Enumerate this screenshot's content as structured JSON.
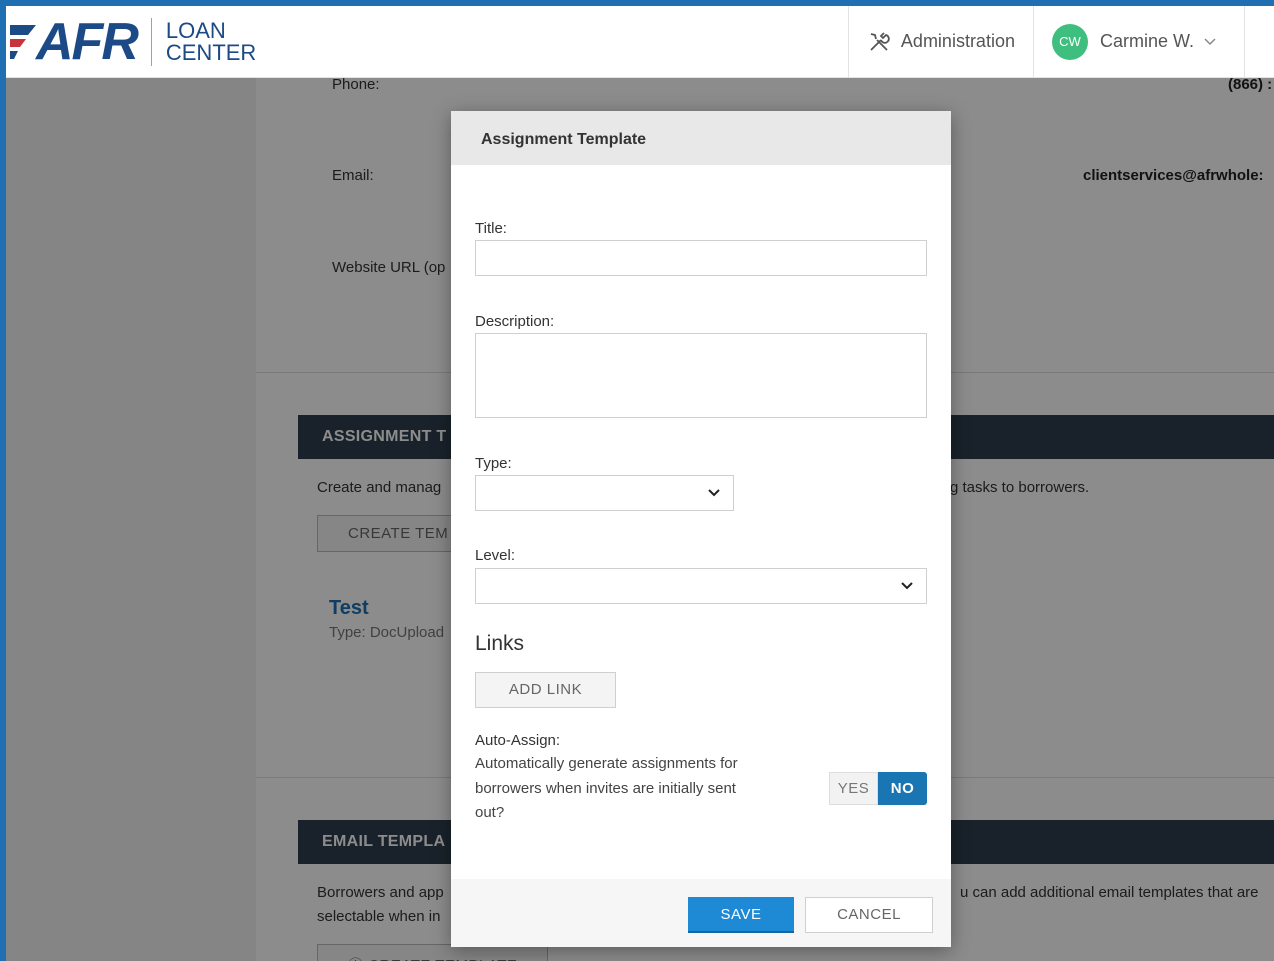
{
  "header": {
    "logo_text": "AFR",
    "logo_sub_line1": "LOAN",
    "logo_sub_line2": "CENTER",
    "admin_label": "Administration",
    "user_initials": "CW",
    "user_name": "Carmine W."
  },
  "settings": {
    "phone_label": "Phone:",
    "phone_value": "(866) :",
    "email_label": "Email:",
    "email_value": "clientservices@afrwhole:",
    "website_label": "Website URL (op"
  },
  "assignment_section": {
    "heading": "ASSIGNMENT T",
    "text_left": "Create and manag",
    "text_right": "g tasks to borrowers.",
    "create_button": "CREATE TEM",
    "template_title": "Test",
    "template_type": "Type: DocUpload"
  },
  "email_section": {
    "heading": "EMAIL TEMPLA",
    "text_line1_left": "Borrowers and app",
    "text_line1_right": "u can add additional email templates that are",
    "text_line2_left": "selectable when in",
    "create_button": "ⓘ CREATE TEMPLATE"
  },
  "modal": {
    "title": "Assignment Template",
    "title_label": "Title:",
    "title_value": "",
    "description_label": "Description:",
    "description_value": "",
    "type_label": "Type:",
    "type_value": "",
    "level_label": "Level:",
    "level_value": "",
    "links_heading": "Links",
    "add_link_button": "ADD LINK",
    "auto_assign_label": "Auto-Assign:",
    "auto_assign_description": "Automatically generate assignments for borrowers when invites are initially sent out?",
    "toggle_yes": "YES",
    "toggle_no": "NO",
    "toggle_selected": "NO",
    "save_button": "SAVE",
    "cancel_button": "CANCEL"
  },
  "colors": {
    "brand_navy": "#1c4a86",
    "accent_blue": "#1e8ad6",
    "section_bar": "#2f3e4e",
    "avatar_green": "#3fbf7f"
  }
}
